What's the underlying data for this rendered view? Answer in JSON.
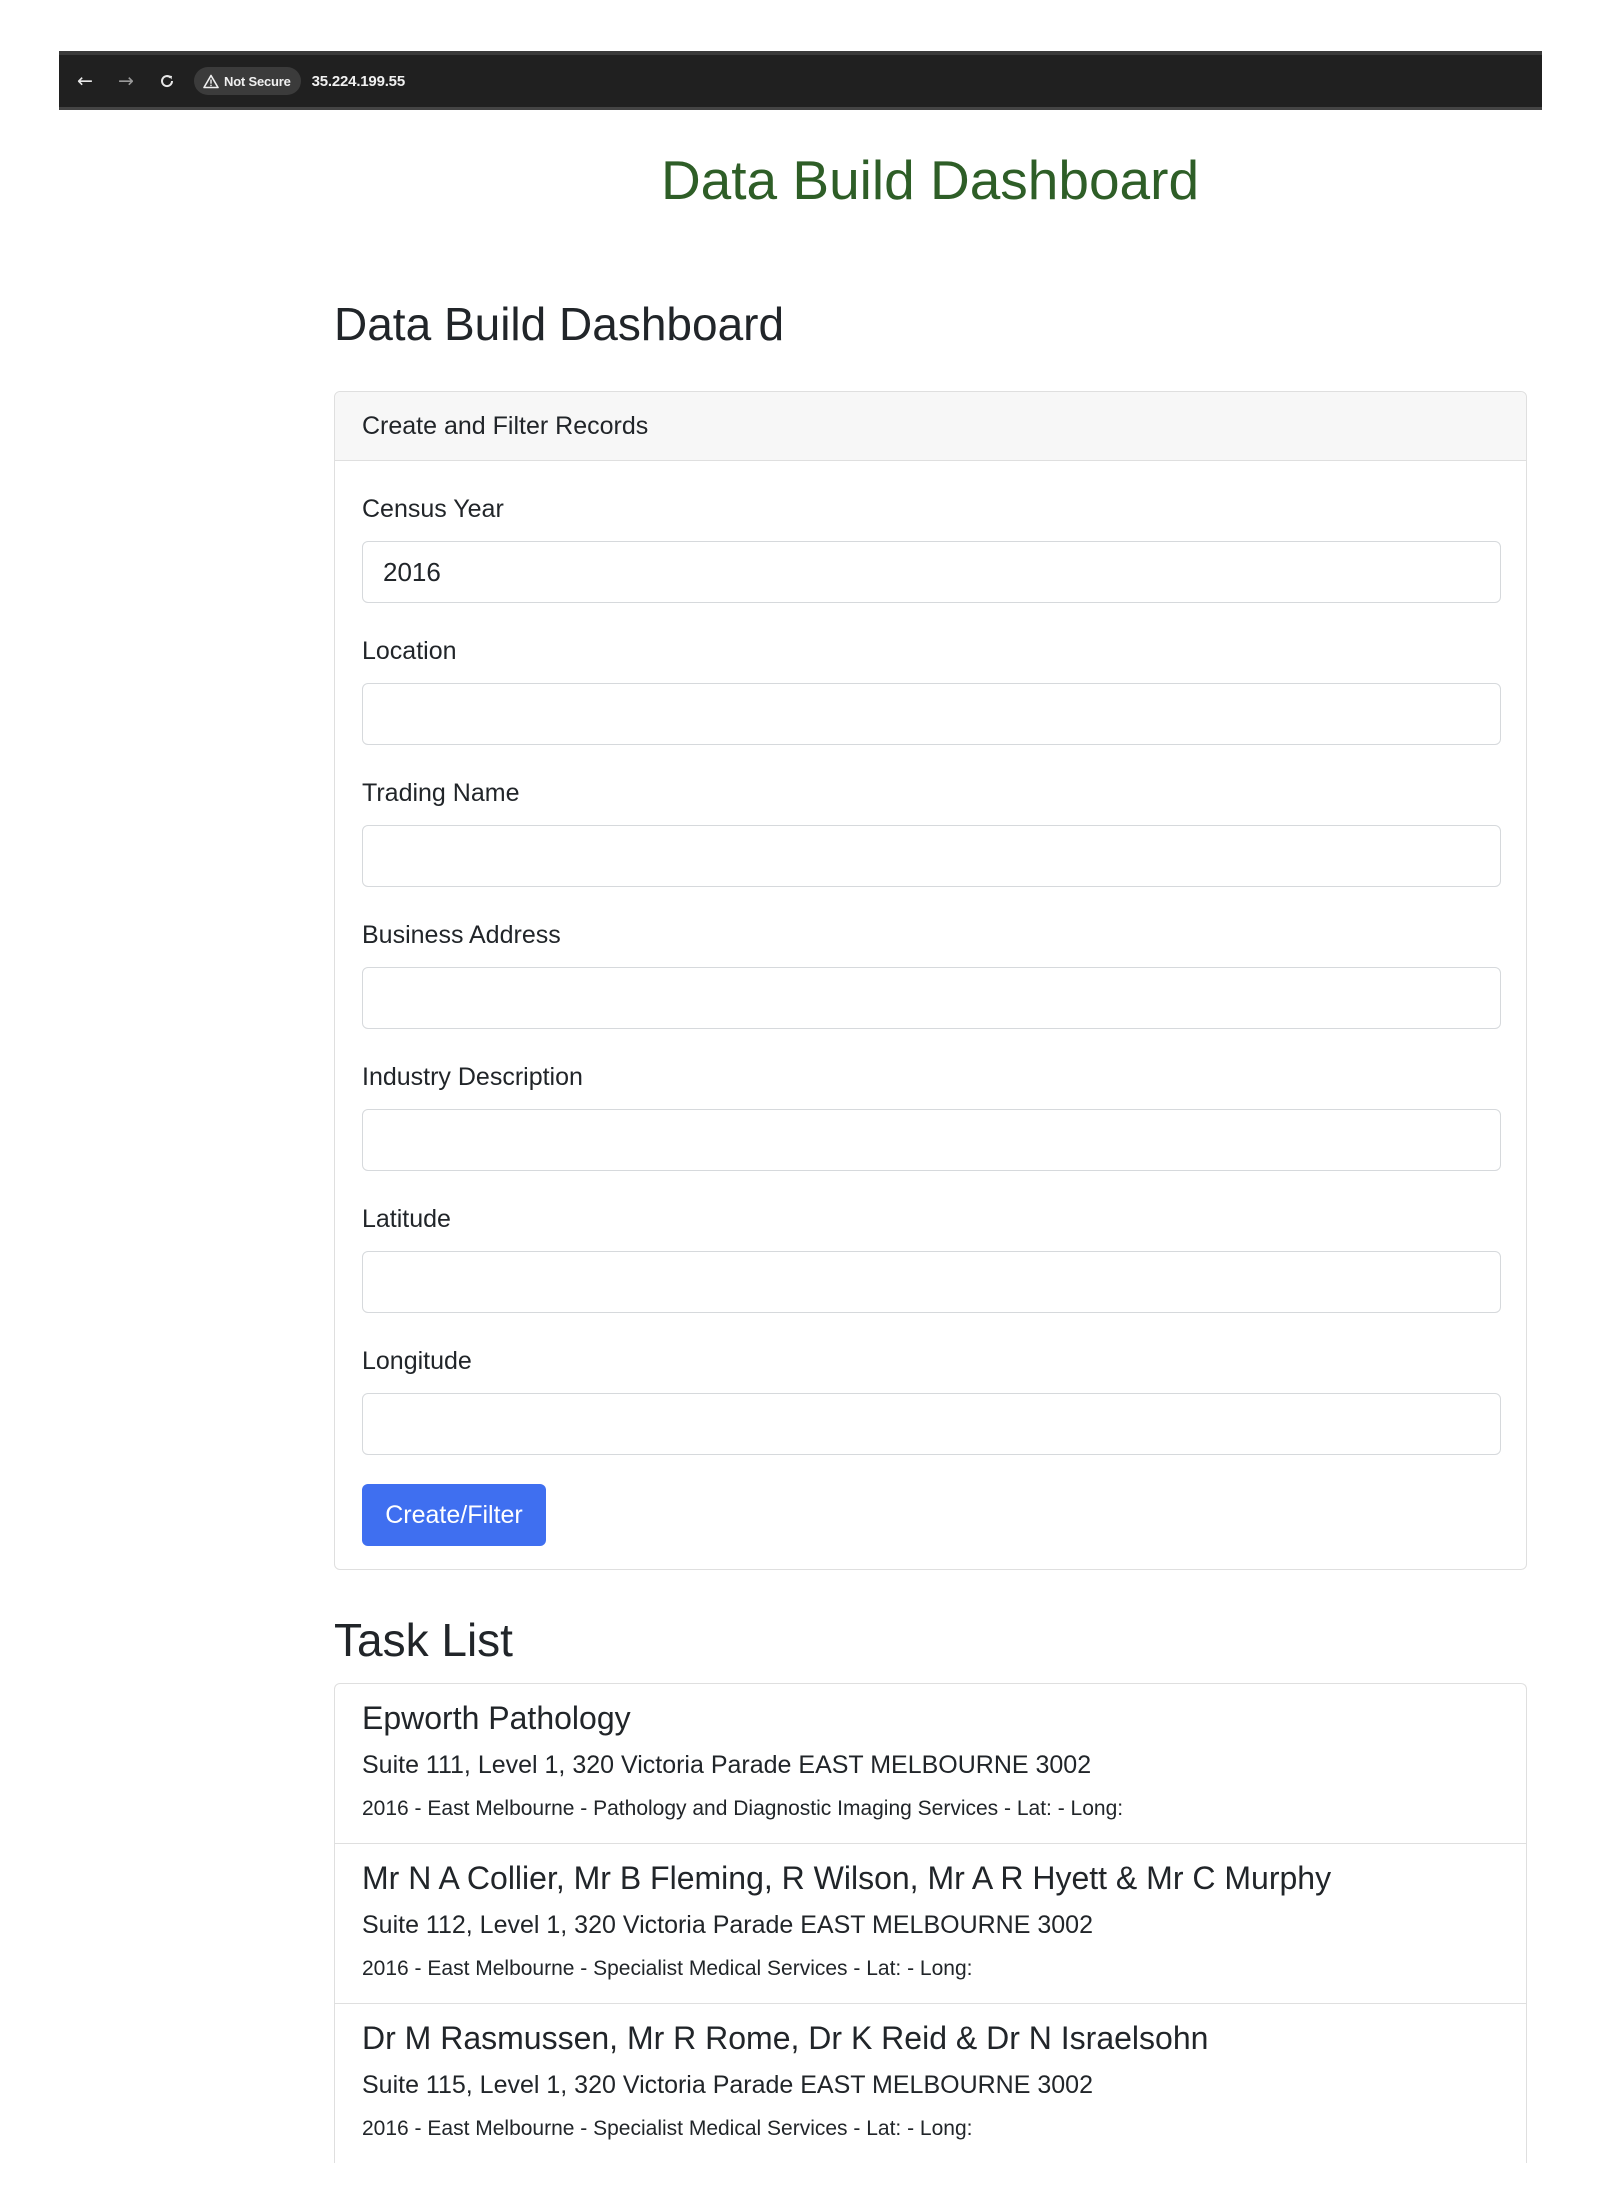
{
  "browser": {
    "back_icon": "arrow-left-icon",
    "forward_icon": "arrow-right-icon",
    "reload_icon": "reload-icon",
    "security_label": "Not Secure",
    "url": "35.224.199.55"
  },
  "site_title": "Data Build Dashboard",
  "page_heading": "Data Build Dashboard",
  "form": {
    "card_title": "Create and Filter Records",
    "fields": [
      {
        "label": "Census Year",
        "value": "2016"
      },
      {
        "label": "Location",
        "value": ""
      },
      {
        "label": "Trading Name",
        "value": ""
      },
      {
        "label": "Business Address",
        "value": ""
      },
      {
        "label": "Industry Description",
        "value": ""
      },
      {
        "label": "Latitude",
        "value": ""
      },
      {
        "label": "Longitude",
        "value": ""
      }
    ],
    "submit_label": "Create/Filter",
    "accent_color": "#3f6ff0"
  },
  "task_list": {
    "heading": "Task List",
    "items": [
      {
        "name": "Epworth Pathology",
        "address": "Suite 111, Level 1, 320 Victoria Parade EAST MELBOURNE 3002",
        "meta": "2016 - East Melbourne - Pathology and Diagnostic Imaging Services - Lat: - Long:"
      },
      {
        "name": "Mr N A Collier, Mr B Fleming, R Wilson, Mr A R Hyett & Mr C Murphy",
        "address": "Suite 112, Level 1, 320 Victoria Parade EAST MELBOURNE 3002",
        "meta": "2016 - East Melbourne - Specialist Medical Services - Lat: - Long:"
      },
      {
        "name": "Dr M Rasmussen, Mr R Rome, Dr K Reid & Dr N Israelsohn",
        "address": "Suite 115, Level 1, 320 Victoria Parade EAST MELBOURNE 3002",
        "meta": "2016 - East Melbourne - Specialist Medical Services - Lat: - Long:"
      }
    ]
  },
  "colors": {
    "title_green": "#2e5e27",
    "browser_bar": "#202020"
  }
}
